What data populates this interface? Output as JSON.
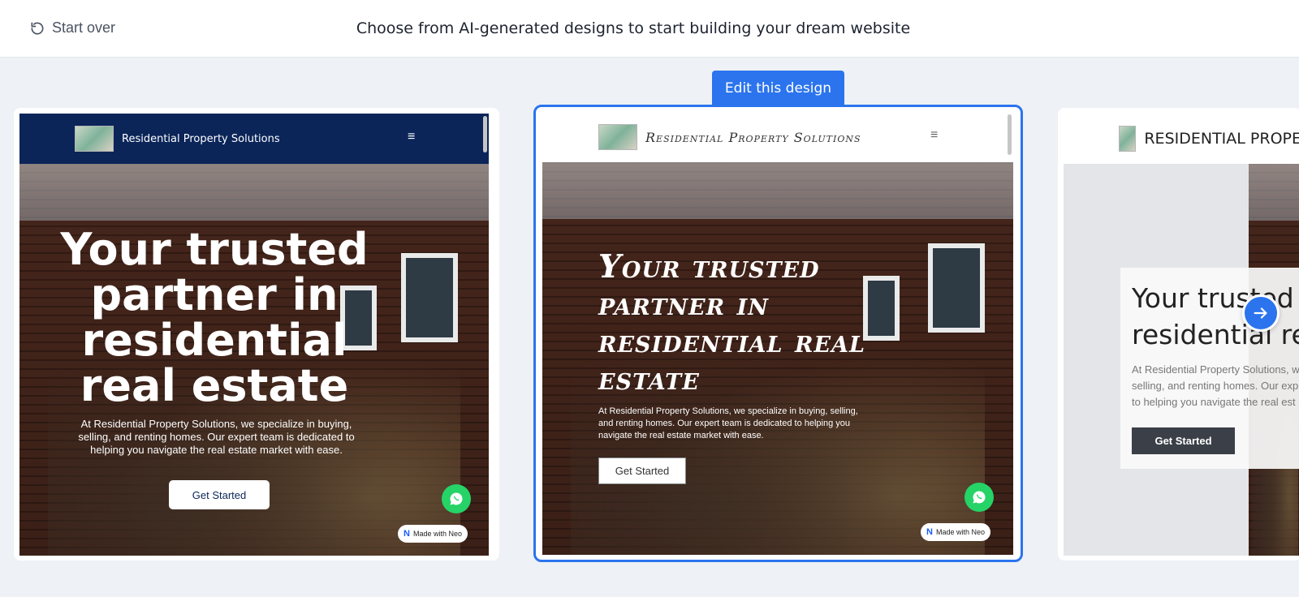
{
  "header": {
    "start_over_label": "Start over",
    "title": "Choose from AI-generated designs to start building your dream website"
  },
  "edit_button_label": "Edit this design",
  "designs": [
    {
      "brand": "Residential Property Solutions",
      "hero_title": "Your trusted partner in residential real estate",
      "hero_text": "At Residential Property Solutions, we specialize in buying, selling, and renting homes. Our expert team is dedicated to helping you navigate the real estate market with ease.",
      "cta": "Get Started",
      "badge": "Made with Neo",
      "nav_color": "#0b2559"
    },
    {
      "brand": "Residential Property Solutions",
      "hero_title": "Your trusted partner in residential real estate",
      "hero_text": "At Residential Property Solutions, we specialize in buying, selling, and renting homes. Our expert team is dedicated to helping you navigate the real estate market with ease.",
      "cta": "Get Started",
      "badge": "Made with Neo",
      "selected": true
    },
    {
      "brand": "RESIDENTIAL PROPE",
      "hero_title_line1": "Your trusted p",
      "hero_title_line2": "residential rea",
      "hero_text_line1": "At Residential Property Solutions, w",
      "hero_text_line2": "selling, and renting homes. Our exp",
      "hero_text_line3": "to helping you navigate the real est",
      "cta": "Get Started"
    }
  ],
  "colors": {
    "accent": "#2b74ee",
    "whatsapp": "#25d366"
  },
  "icons": {
    "start_over": "refresh-icon",
    "menu": "hamburger-icon",
    "chat": "whatsapp-icon",
    "next": "arrow-right-icon"
  }
}
